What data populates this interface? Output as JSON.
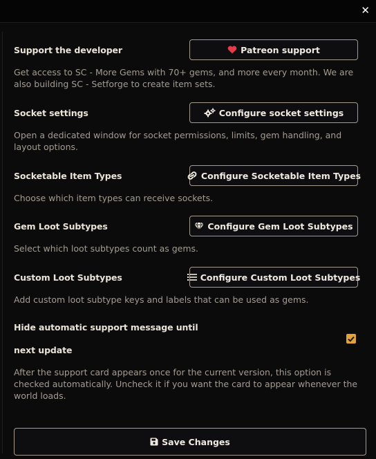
{
  "window": {
    "close_icon": "close-icon"
  },
  "settings": [
    {
      "id": "support",
      "label": "Support the developer",
      "button": "Patreon support",
      "icon": "heart-icon",
      "hint": "Get access to SC - More Gems with 70+ gems, and more every month. We are also building SC - Setforge to create item sets."
    },
    {
      "id": "socket",
      "label": "Socket settings",
      "button": "Configure socket settings",
      "icon": "gears-icon",
      "hint": "Open a dedicated window for socket permissions, limits, gem handling, and layout options."
    },
    {
      "id": "item-types",
      "label": "Socketable Item Types",
      "button": "Configure Socketable Item Types",
      "icon": "link-icon",
      "hint": "Choose which item types can receive sockets."
    },
    {
      "id": "gem-loot",
      "label": "Gem Loot Subtypes",
      "button": "Configure Gem Loot Subtypes",
      "icon": "gem-icon",
      "hint": "Select which loot subtypes count as gems."
    },
    {
      "id": "custom-loot",
      "label": "Custom Loot Subtypes",
      "button": "Configure Custom Loot Subtypes",
      "icon": "list-icon",
      "hint": "Add custom loot subtype keys and labels that can be used as gems."
    }
  ],
  "hide_support": {
    "label_line1": "Hide automatic support message until",
    "label_line2": "next update",
    "checked": true,
    "hint": "After the support card appears once for the current version, this option is checked automatically. Uncheck it if you want the card to appear whenever the world loads."
  },
  "footer": {
    "save_label": "Save Changes",
    "icon": "save-icon"
  },
  "colors": {
    "accent": "#e0a23a",
    "heart": "#e53b4a",
    "background": "#0b0b0c"
  }
}
